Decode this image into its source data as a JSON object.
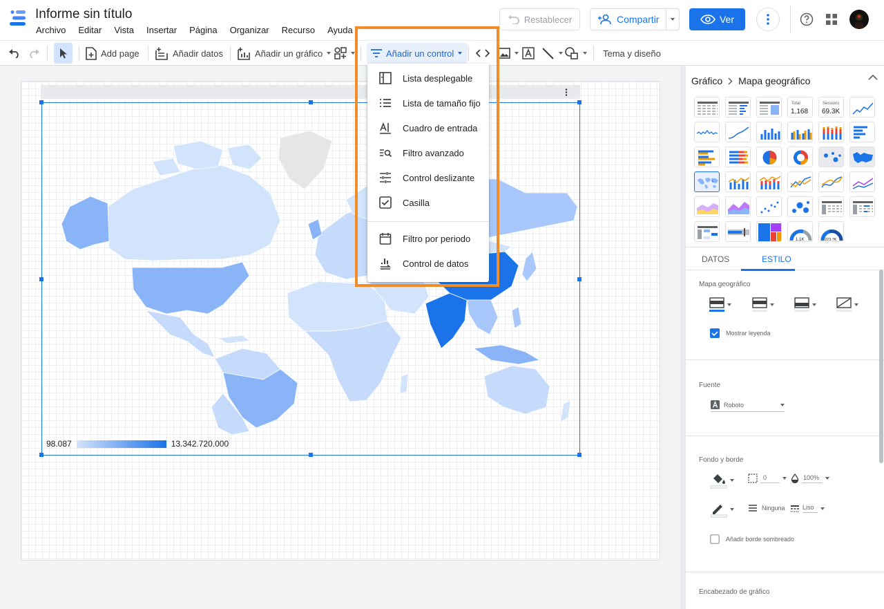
{
  "app": {
    "title": "Informe sin título",
    "menus": [
      "Archivo",
      "Editar",
      "Vista",
      "Insertar",
      "Página",
      "Organizar",
      "Recurso",
      "Ayuda"
    ]
  },
  "header": {
    "reset_label": "Restablecer",
    "share_label": "Compartir",
    "view_label": "Ver"
  },
  "toolbar": {
    "add_page": "Add page",
    "add_data": "Añadir datos",
    "add_chart": "Añadir un gráfico",
    "add_control": "Añadir un control",
    "theme": "Tema y diseño"
  },
  "control_menu": {
    "items": [
      {
        "label": "Lista desplegable",
        "icon": "dropdown-list-icon"
      },
      {
        "label": "Lista de tamaño fijo",
        "icon": "fixed-list-icon"
      },
      {
        "label": "Cuadro de entrada",
        "icon": "input-box-icon"
      },
      {
        "label": "Filtro avanzado",
        "icon": "advanced-filter-icon"
      },
      {
        "label": "Control deslizante",
        "icon": "slider-icon"
      },
      {
        "label": "Casilla",
        "icon": "checkbox-icon"
      },
      {
        "label": "Filtro por periodo",
        "icon": "calendar-icon"
      },
      {
        "label": "Control de datos",
        "icon": "data-control-icon"
      }
    ]
  },
  "chart": {
    "legend_min": "98.087",
    "legend_max": "13.342.720.000"
  },
  "panel": {
    "breadcrumb_root": "Gráfico",
    "breadcrumb_leaf": "Mapa geográfico",
    "tabs": [
      "DATOS",
      "ESTILO"
    ],
    "active_tab": "ESTILO",
    "thumb_total_label": "Total",
    "thumb_total_value": "1,168",
    "thumb_sessions_label": "Sessions",
    "thumb_sessions_value": "69.3K",
    "thumb_gauge1": "1.1K",
    "thumb_gauge2": "223.7K",
    "geo_section": "Mapa geográfico",
    "show_legend": "Mostrar leyenda",
    "font_section": "Fuente",
    "font_value": "Roboto",
    "bg_section": "Fondo y borde",
    "radius_value": "0",
    "opacity_value": "100%",
    "border_weight": "Ninguna",
    "border_style": "Liso",
    "shadow_label": "Añadir borde sombreado",
    "header_section": "Encabezado de gráfico"
  },
  "colors": {
    "accent": "#1a73e8",
    "highlight": "#f28c28",
    "map_light": "#d2e3fc",
    "map_dark": "#1a73e8"
  }
}
